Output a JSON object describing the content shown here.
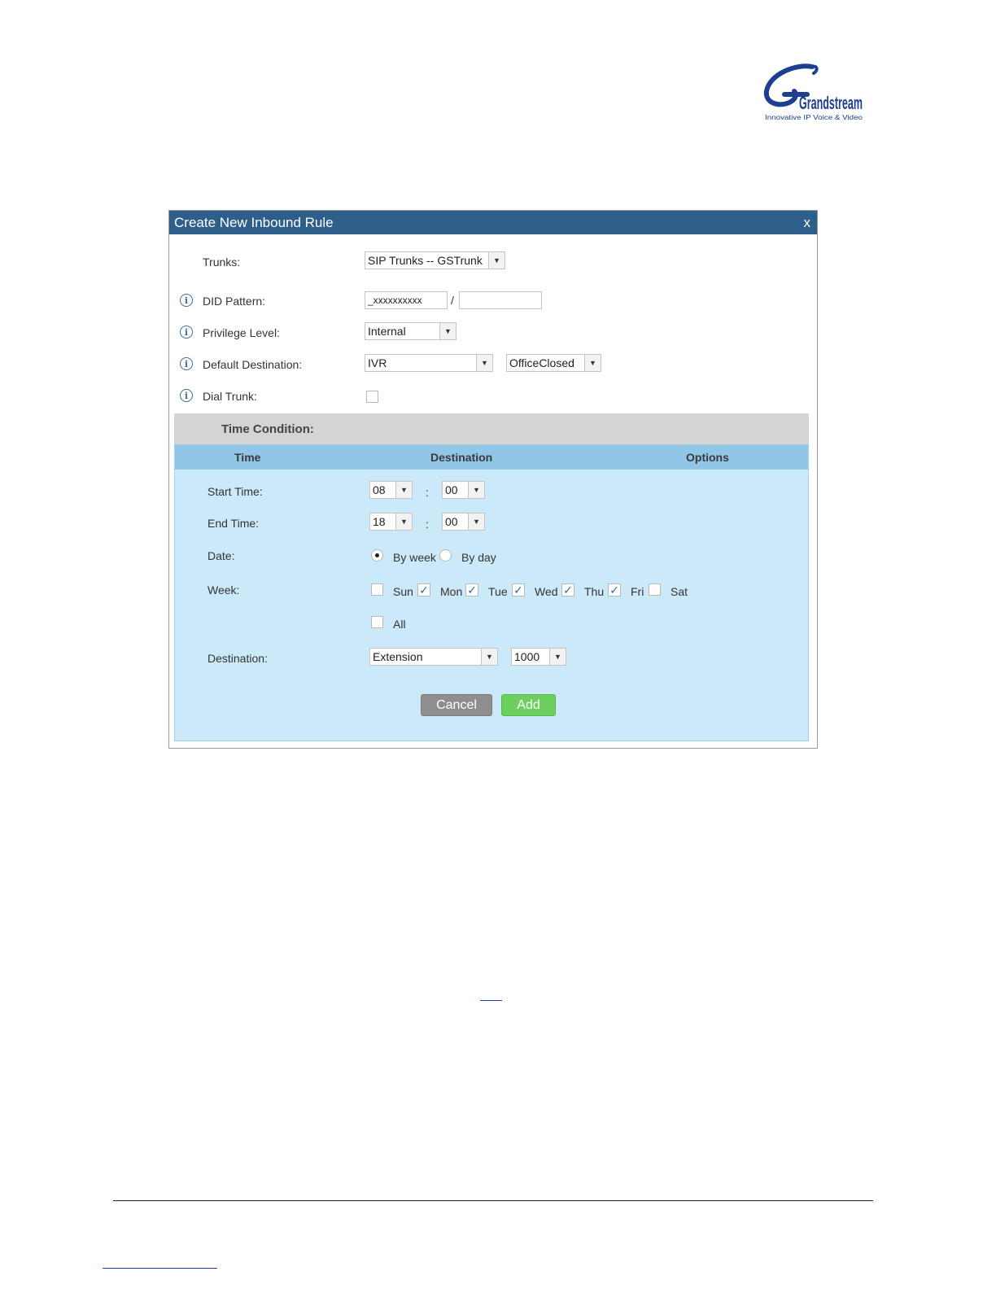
{
  "logo": {
    "brand": "Grandstream",
    "tagline": "Innovative IP Voice & Video"
  },
  "dialog": {
    "title": "Create New Inbound Rule",
    "close_label": "x",
    "fields": {
      "trunks": {
        "label": "Trunks:",
        "value": "SIP Trunks -- GSTrunk"
      },
      "did_pattern": {
        "label": "DID Pattern:",
        "value": "_xxxxxxxxxx",
        "separator": "/",
        "value2": ""
      },
      "privilege_level": {
        "label": "Privilege Level:",
        "value": "Internal"
      },
      "default_destination": {
        "label": "Default Destination:",
        "value": "IVR",
        "value2": "OfficeClosed"
      },
      "dial_trunk": {
        "label": "Dial Trunk:",
        "checked": false
      }
    },
    "time_condition": {
      "title": "Time Condition:",
      "columns": [
        "Time",
        "Destination",
        "Options"
      ],
      "start_time": {
        "label": "Start Time:",
        "hour": "08",
        "minute": "00"
      },
      "end_time": {
        "label": "End Time:",
        "hour": "18",
        "minute": "00"
      },
      "colon": ":",
      "date": {
        "label": "Date:",
        "options": [
          "By week",
          "By day"
        ],
        "selected": "By week"
      },
      "week": {
        "label": "Week:",
        "days": [
          {
            "name": "Sun",
            "checked": false
          },
          {
            "name": "Mon",
            "checked": true
          },
          {
            "name": "Tue",
            "checked": true
          },
          {
            "name": "Wed",
            "checked": true
          },
          {
            "name": "Thu",
            "checked": true
          },
          {
            "name": "Fri",
            "checked": true
          },
          {
            "name": "Sat",
            "checked": false
          }
        ],
        "all_label": "All"
      },
      "destination": {
        "label": "Destination:",
        "type": "Extension",
        "value": "1000"
      },
      "buttons": {
        "cancel": "Cancel",
        "add": "Add"
      }
    }
  },
  "colors": {
    "header": "#2d5f8a",
    "panel": "#cce9f9",
    "panel_head": "#92c6e6",
    "add": "#6ccf5e",
    "cancel": "#8e8e8e"
  }
}
